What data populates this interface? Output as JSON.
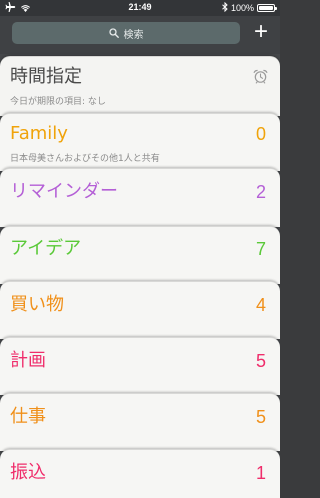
{
  "status_bar": {
    "time": "21:49",
    "battery": "100%",
    "icons": [
      "airplane-icon",
      "wifi-icon",
      "bluetooth-icon",
      "battery-icon"
    ]
  },
  "header": {
    "search_placeholder": "検索",
    "add_label": "+"
  },
  "scheduled": {
    "title": "時間指定",
    "subtitle": "今日が期限の項目: なし"
  },
  "lists": [
    {
      "title": "Family",
      "count": "0",
      "subtitle": "日本母美さんおよびその他1人と共有",
      "color": "#f0a30a"
    },
    {
      "title": "リマインダー",
      "count": "2",
      "color": "#b45fd6"
    },
    {
      "title": "アイデア",
      "count": "7",
      "color": "#5ac938"
    },
    {
      "title": "買い物",
      "count": "4",
      "color": "#f0901a"
    },
    {
      "title": "計画",
      "count": "5",
      "color": "#ef2d6b"
    },
    {
      "title": "仕事",
      "count": "5",
      "color": "#f0901a"
    },
    {
      "title": "振込",
      "count": "1",
      "color": "#ef2d6b"
    }
  ]
}
